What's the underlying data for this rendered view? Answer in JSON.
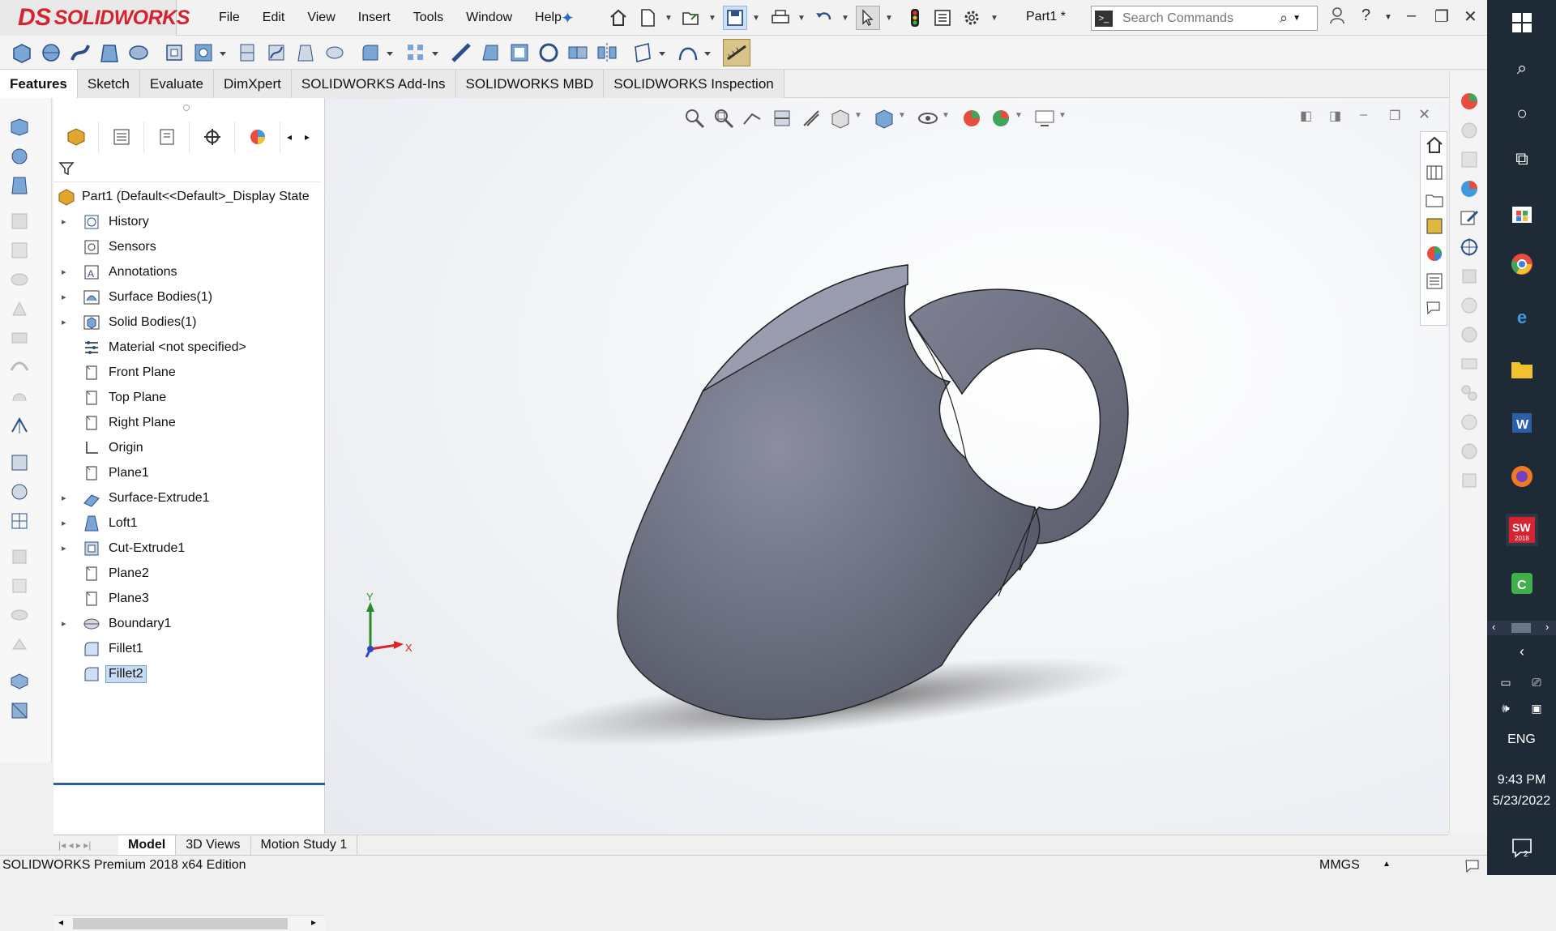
{
  "app": {
    "logo": "SOLIDWORKS",
    "logo_mark": "DS",
    "document_title": "Part1 *"
  },
  "menu": [
    "File",
    "Edit",
    "View",
    "Insert",
    "Tools",
    "Window",
    "Help"
  ],
  "search": {
    "placeholder": "Search Commands"
  },
  "tabs": [
    "Features",
    "Sketch",
    "Evaluate",
    "DimXpert",
    "SOLIDWORKS Add-Ins",
    "SOLIDWORKS MBD",
    "SOLIDWORKS Inspection"
  ],
  "active_tab": "Features",
  "tree": {
    "root": "Part1  (Default<<Default>_Display State",
    "items": [
      {
        "label": "History",
        "icon": "history-icon",
        "expandable": true
      },
      {
        "label": "Sensors",
        "icon": "sensors-icon",
        "expandable": false
      },
      {
        "label": "Annotations",
        "icon": "annotations-icon",
        "expandable": true
      },
      {
        "label": "Surface Bodies(1)",
        "icon": "surface-bodies-icon",
        "expandable": true
      },
      {
        "label": "Solid Bodies(1)",
        "icon": "solid-bodies-icon",
        "expandable": true
      },
      {
        "label": "Material <not specified>",
        "icon": "material-icon",
        "expandable": false
      },
      {
        "label": "Front Plane",
        "icon": "plane-icon",
        "expandable": false
      },
      {
        "label": "Top Plane",
        "icon": "plane-icon",
        "expandable": false
      },
      {
        "label": "Right Plane",
        "icon": "plane-icon",
        "expandable": false
      },
      {
        "label": "Origin",
        "icon": "origin-icon",
        "expandable": false
      },
      {
        "label": "Plane1",
        "icon": "plane-icon",
        "expandable": false
      },
      {
        "label": "Surface-Extrude1",
        "icon": "surface-extrude-icon",
        "expandable": true
      },
      {
        "label": "Loft1",
        "icon": "loft-icon",
        "expandable": true
      },
      {
        "label": "Cut-Extrude1",
        "icon": "cut-extrude-icon",
        "expandable": true
      },
      {
        "label": "Plane2",
        "icon": "plane-icon",
        "expandable": false
      },
      {
        "label": "Plane3",
        "icon": "plane-icon",
        "expandable": false
      },
      {
        "label": "Boundary1",
        "icon": "boundary-icon",
        "expandable": true
      },
      {
        "label": "Fillet1",
        "icon": "fillet-icon",
        "expandable": false
      },
      {
        "label": "Fillet2",
        "icon": "fillet-icon",
        "expandable": false,
        "selected": true
      }
    ]
  },
  "triad": {
    "y": "Y",
    "x": "X"
  },
  "bottom_tabs": [
    "Model",
    "3D Views",
    "Motion Study 1"
  ],
  "status": {
    "left": "SOLIDWORKS Premium 2018 x64 Edition",
    "units": "MMGS"
  },
  "taskbar": {
    "language": "ENG",
    "time": "9:43 PM",
    "date": "5/23/2022",
    "notifications": "2",
    "sw_badge": "2018"
  },
  "colors": {
    "brand_red": "#d5232f",
    "model_gray": "#6b6f7f",
    "selection_blue": "#c6dcf5",
    "taskbar": "#1f2a37"
  }
}
